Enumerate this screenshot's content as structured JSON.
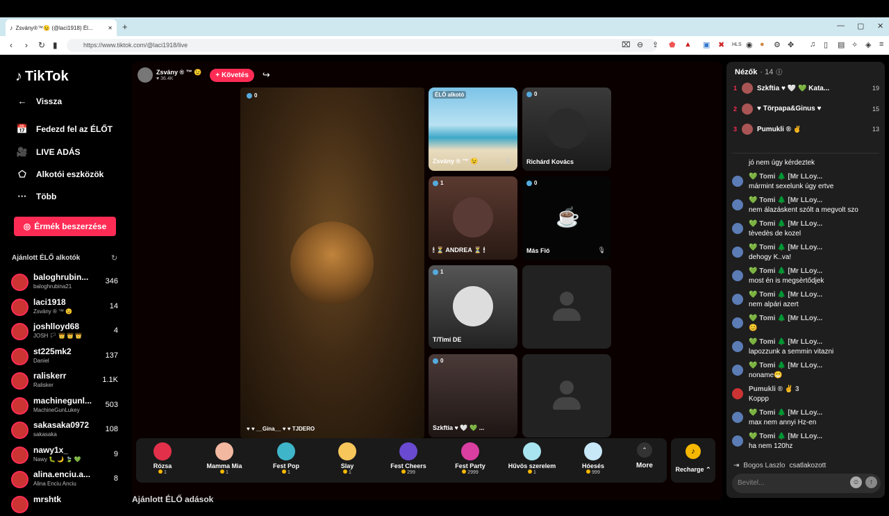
{
  "browser": {
    "tab_title": "Zsvány®™😉 (@laci1918) Él...",
    "new_tab": "+",
    "url": "https://www.tiktok.com/@laci1918/live",
    "minimize": "—",
    "maximize": "▢",
    "close": "✕"
  },
  "sidebar": {
    "logo": "TikTok",
    "items": [
      {
        "icon": "back-icon",
        "glyph": "←",
        "label": "Vissza"
      },
      {
        "icon": "explore-live-icon",
        "glyph": "📅",
        "label": "Fedezd fel az ÉLŐT"
      },
      {
        "icon": "live-broadcast-icon",
        "glyph": "🎥",
        "label": "LIVE ADÁS"
      },
      {
        "icon": "creator-tools-icon",
        "glyph": "⬠",
        "label": "Alkotói eszközök"
      },
      {
        "icon": "more-icon",
        "glyph": "···",
        "label": "Több"
      }
    ],
    "coins_button": "Érmék beszerzése",
    "recommended_title": "Ajánlott ÉLŐ alkotók",
    "creators": [
      {
        "name": "baloghrubin...",
        "sub": "baloghrubina21",
        "count": "346"
      },
      {
        "name": "laci1918",
        "sub": "Zsvány ® ™ 😉",
        "count": "14"
      },
      {
        "name": "joshlloyd68",
        "sub": "JOSH 🏳 👑 👑 👑",
        "count": "4"
      },
      {
        "name": "st225mk2",
        "sub": "Daniel",
        "count": "137"
      },
      {
        "name": "raliskerr",
        "sub": "Ralisker",
        "count": "1.1K"
      },
      {
        "name": "machinegunl...",
        "sub": "MachineGunLukey",
        "count": "503"
      },
      {
        "name": "sakasaka0972",
        "sub": "sakasaka",
        "count": "108"
      },
      {
        "name": "nawy1x_",
        "sub": "Nawy 🐛 🌙 🍃 💚",
        "count": "9"
      },
      {
        "name": "alina.enciu.a...",
        "sub": "Alina Enciu Anciu",
        "count": "8"
      },
      {
        "name": "mrshtk",
        "sub": "",
        "count": ""
      }
    ]
  },
  "stream": {
    "host_name": "Zsvány ® ™ 😉",
    "host_likes": "♥ 36.4K",
    "follow_button": "+ Követés",
    "share_icon": "↪",
    "main_viewers": "0",
    "main_guest_name": "♥ ♥ __Gina__ ♥ ♥ TJDERO",
    "tiles": [
      {
        "label": "ÉLŐ alkotó",
        "name": "Zsvány ® ™ 😉",
        "badge": ""
      },
      {
        "label": "",
        "name": "Richárd Kovács",
        "badge": "0"
      },
      {
        "label": "",
        "name": "🕯 ⏳ ANDREA ⏳ 🕯",
        "badge": "1"
      },
      {
        "label": "",
        "name": "Más Fió",
        "badge": "0"
      },
      {
        "label": "",
        "name": "T/Timi DE",
        "badge": "1"
      },
      {
        "label": "",
        "name": "",
        "badge": ""
      },
      {
        "label": "",
        "name": "Szkftia ♥ 🤍 💚 ...",
        "badge": "0"
      },
      {
        "label": "",
        "name": "",
        "badge": ""
      }
    ],
    "bottom_title": "Ajánlott ÉLŐ adások"
  },
  "gifts": [
    {
      "name": "Rózsa",
      "price": "1",
      "color": "#e2304a"
    },
    {
      "name": "Mamma Mia",
      "price": "1",
      "color": "#f2b8a0"
    },
    {
      "name": "Fest Pop",
      "price": "1",
      "color": "#3fb5c9"
    },
    {
      "name": "Slay",
      "price": "1",
      "color": "#f6c65b"
    },
    {
      "name": "Fest Cheers",
      "price": "299",
      "color": "#6a4ad1"
    },
    {
      "name": "Fest Party",
      "price": "2999",
      "color": "#d93ea1"
    },
    {
      "name": "Hűvös szerelem",
      "price": "1",
      "color": "#a8e4f0"
    },
    {
      "name": "Hóesés",
      "price": "999",
      "color": "#c8e8f8"
    }
  ],
  "more_label": "More",
  "recharge_label": "Recharge ⌃",
  "chat": {
    "viewers_title": "Nézők",
    "viewers_count": "· 14",
    "top_viewers": [
      {
        "rank": "1",
        "name": "Szkftia ♥ 🤍 💚 Kata...",
        "score": "19"
      },
      {
        "rank": "2",
        "name": "♥ Törpapa&Ginus ♥",
        "score": "15"
      },
      {
        "rank": "3",
        "name": "Pumukli ® ✌",
        "score": "13"
      }
    ],
    "messages": [
      {
        "who": "",
        "text": "jó nem úgy kérdeztek"
      },
      {
        "who": "💚 Tomi 🌲 [Mr LLoy...",
        "text": "mármint sexelunk úgy ertve"
      },
      {
        "who": "💚 Tomi 🌲 [Mr LLoy...",
        "text": "nem álazáskent szólt a megvolt szo"
      },
      {
        "who": "💚 Tomi 🌲 [Mr LLoy...",
        "text": "tèvedès de kozel"
      },
      {
        "who": "💚 Tomi 🌲 [Mr LLoy...",
        "text": "dehogy K..va!"
      },
      {
        "who": "💚 Tomi 🌲 [Mr LLoy...",
        "text": "most én is megsèrtődjek"
      },
      {
        "who": "💚 Tomi 🌲 [Mr LLoy...",
        "text": "nem alpári azert"
      },
      {
        "who": "💚 Tomi 🌲 [Mr LLoy...",
        "text": "😊"
      },
      {
        "who": "💚 Tomi 🌲 [Mr LLoy...",
        "text": "lapozzunk a semmin vitazni"
      },
      {
        "who": "💚 Tomi 🌲 [Mr LLoy...",
        "text": "noname😁"
      },
      {
        "who": "Pumukli ® ✌ 3",
        "text": "Koppp"
      },
      {
        "who": "💚 Tomi 🌲 [Mr LLoy...",
        "text": "max nem annyi Hz-en"
      },
      {
        "who": "💚 Tomi 🌲 [Mr LLoy...",
        "text": "ha nem 120hz"
      }
    ],
    "joined_name": "Bogos Laszlo",
    "joined_text": "csatlakozott",
    "input_placeholder": "Bevitel...",
    "emoji_glyph": "☺",
    "send_glyph": "↑"
  }
}
